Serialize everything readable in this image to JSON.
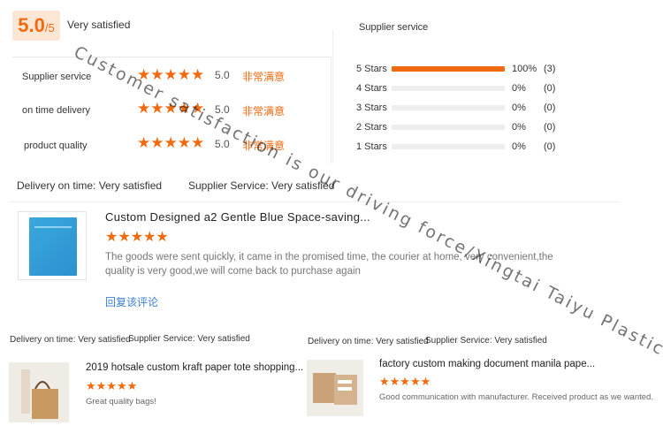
{
  "summary": {
    "score_value": "5.0",
    "score_outof": "/5",
    "score_text": "Very satisfied"
  },
  "metrics": [
    {
      "label": "Supplier service",
      "stars": "★★★★★",
      "value": "5.0",
      "cn": "非常满意"
    },
    {
      "label": "on time delivery",
      "stars": "★★★★★",
      "value": "5.0",
      "cn": "非常满意"
    },
    {
      "label": "product quality",
      "stars": "★★★★★",
      "value": "5.0",
      "cn": "非常满意"
    }
  ],
  "supplier_service": {
    "title": "Supplier service",
    "rows": [
      {
        "label": "5 Stars",
        "pct_text": "100%",
        "count": "(3)",
        "fraction": 1.0
      },
      {
        "label": "4 Stars",
        "pct_text": "0%",
        "count": "(0)",
        "fraction": 0
      },
      {
        "label": "3 Stars",
        "pct_text": "0%",
        "count": "(0)",
        "fraction": 0
      },
      {
        "label": "2 Stars",
        "pct_text": "0%",
        "count": "(0)",
        "fraction": 0
      },
      {
        "label": "1 Stars",
        "pct_text": "0%",
        "count": "(0)",
        "fraction": 0
      }
    ]
  },
  "review_main": {
    "delivery": "Delivery on time: Very satisfied",
    "service": "Supplier Service: Very satisfied",
    "product_title": "Custom Designed a2 Gentle Blue Space-saving...",
    "stars": "★★★★★",
    "text": "The goods were sent quickly, it came in the promised time, the courier at home, very convenient,the quality is very good,we will come back to purchase again",
    "reply": "回复该评论"
  },
  "review_left": {
    "delivery": "Delivery on time: Very satisfied",
    "service": "Supplier Service: Very satisfied",
    "product_title": "2019 hotsale custom kraft paper tote shopping...",
    "stars": "★★★★★",
    "text": "Great quality bags!"
  },
  "review_right": {
    "delivery": "Delivery on time: Very satisfied",
    "service": "Supplier Service: Very satisfied",
    "product_title": "factory custom making document manila pape...",
    "stars": "★★★★★",
    "text": "Good communication with manufacturer.  Received product as we wanted."
  },
  "watermark": "Customer satisfaction is our driving force/Xingtai Taiyu Plastic Co.,Ltd",
  "colors": {
    "accent": "#f26a10",
    "link": "#3a7fd5"
  }
}
